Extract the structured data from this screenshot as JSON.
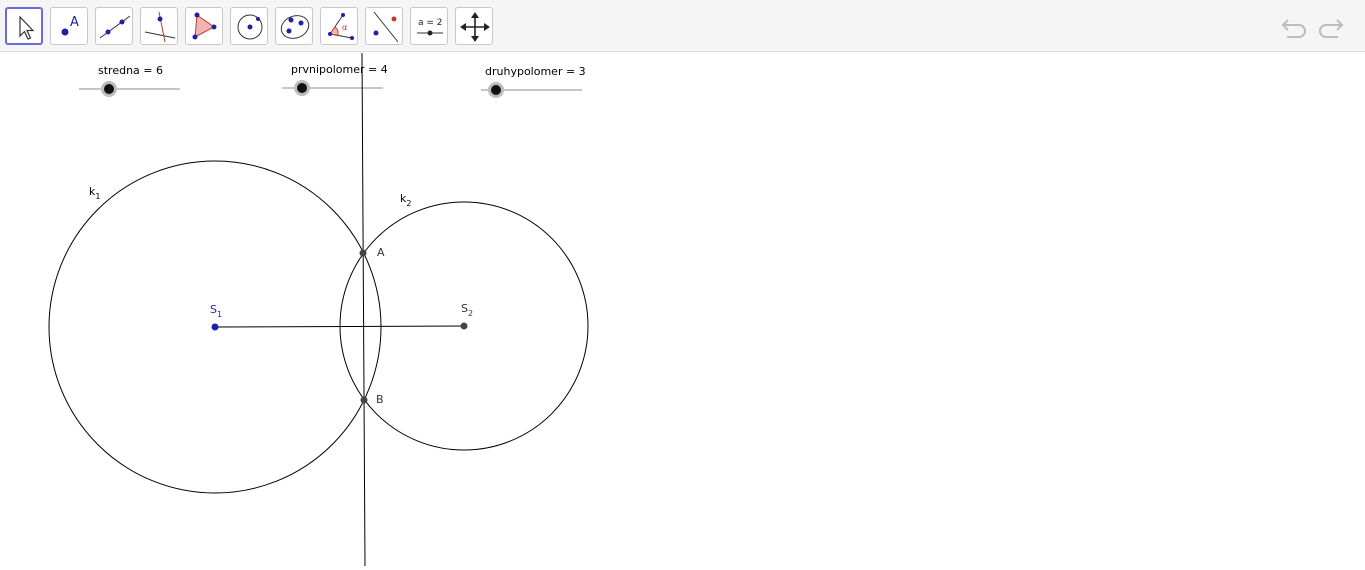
{
  "toolbar": {
    "tools": [
      {
        "name": "move",
        "selected": true
      },
      {
        "name": "point",
        "icon_text": "A"
      },
      {
        "name": "line"
      },
      {
        "name": "perpendicular-line"
      },
      {
        "name": "polygon"
      },
      {
        "name": "circle-center-point"
      },
      {
        "name": "ellipse"
      },
      {
        "name": "angle",
        "icon_text": "α"
      },
      {
        "name": "reflect-about-line"
      },
      {
        "name": "slider",
        "icon_text": "a = 2"
      },
      {
        "name": "move-graphics-view"
      }
    ],
    "undo_icon": "undo-icon",
    "redo_icon": "redo-icon"
  },
  "sliders": [
    {
      "label": "stredna = 6",
      "name": "stredna",
      "value": 6
    },
    {
      "label": "prvnipolomer = 4",
      "name": "prvnipolomer",
      "value": 4
    },
    {
      "label": "druhypolomer = 3",
      "name": "druhypolomer",
      "value": 3
    }
  ],
  "labels": {
    "k1_main": "k",
    "k1_sub": "1",
    "k2_main": "k",
    "k2_sub": "2",
    "s1_main": "S",
    "s1_sub": "1",
    "s2_main": "S",
    "s2_sub": "2",
    "a": "A",
    "b": "B"
  },
  "colors": {
    "accent": "#6b6bdc",
    "point_blue": "#1f1fa8",
    "point_dark": "#444444",
    "line": "#000000",
    "label_gray": "#333333"
  }
}
